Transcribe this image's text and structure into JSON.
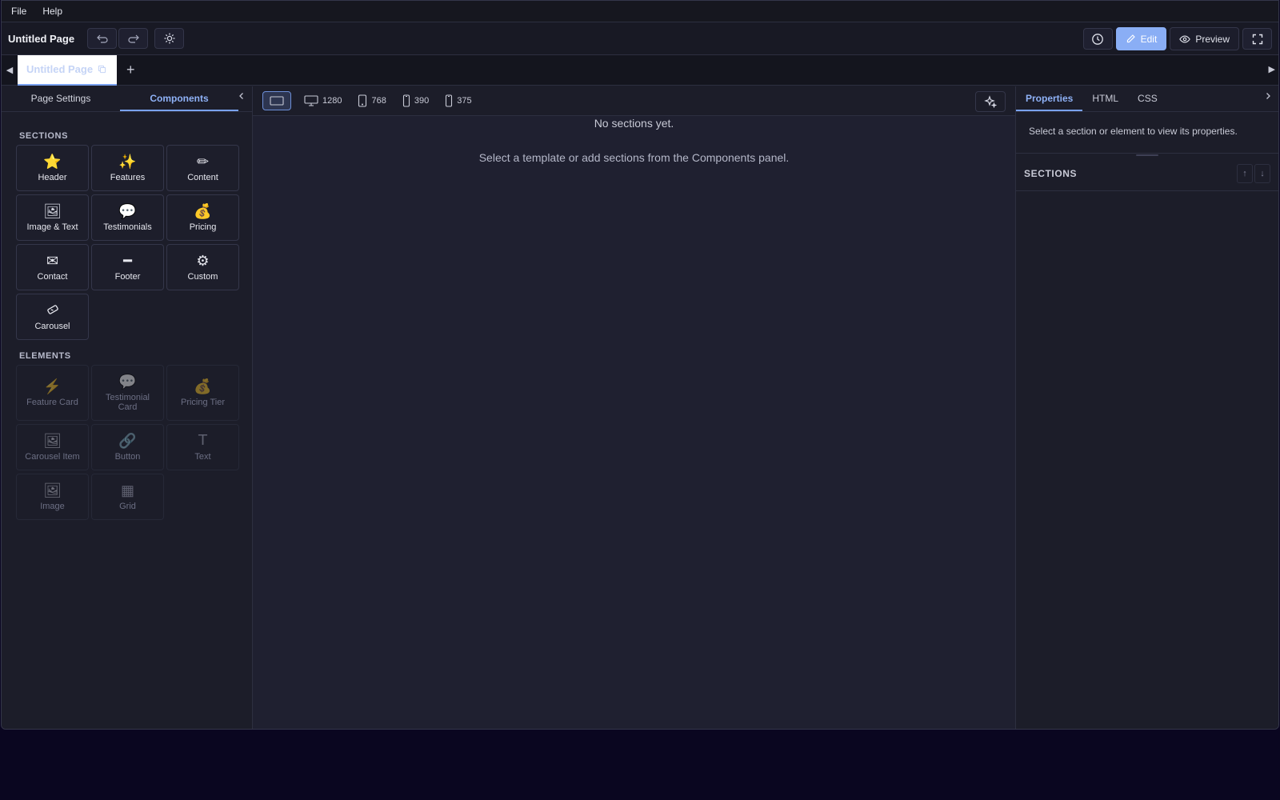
{
  "menu": {
    "file": "File",
    "help": "Help"
  },
  "toolbar": {
    "page_name": "Untitled Page",
    "edit_label": "Edit",
    "preview_label": "Preview"
  },
  "tabs": {
    "active_tab": "Untitled Page",
    "add": "+",
    "left_arrow": "◀",
    "right_arrow": "▶"
  },
  "left_panel": {
    "tabs": [
      "Page Settings",
      "Components"
    ],
    "active_tab": "Components",
    "sections_title": "SECTIONS",
    "sections": [
      {
        "label": "Header",
        "icon": "⭐"
      },
      {
        "label": "Features",
        "icon": "✨"
      },
      {
        "label": "Content",
        "icon": "✏"
      },
      {
        "label": "Image & Text",
        "icon": "🖼"
      },
      {
        "label": "Testimonials",
        "icon": "💬"
      },
      {
        "label": "Pricing",
        "icon": "💰"
      },
      {
        "label": "Contact",
        "icon": "✉"
      },
      {
        "label": "Footer",
        "icon": "━"
      },
      {
        "label": "Custom",
        "icon": "⚙"
      },
      {
        "label": "Carousel",
        "icon": "🎠"
      }
    ],
    "elements_title": "ELEMENTS",
    "elements": [
      {
        "label": "Feature Card",
        "icon": "⚡"
      },
      {
        "label": "Testimonial Card",
        "icon": "💬"
      },
      {
        "label": "Pricing Tier",
        "icon": "💰"
      },
      {
        "label": "Carousel Item",
        "icon": "🖼"
      },
      {
        "label": "Button",
        "icon": "🔗"
      },
      {
        "label": "Text",
        "icon": "T"
      },
      {
        "label": "Image",
        "icon": "🖼"
      },
      {
        "label": "Grid",
        "icon": "▦"
      }
    ]
  },
  "canvas": {
    "devices": [
      {
        "name": "fit",
        "label": ""
      },
      {
        "name": "desktop",
        "label": "1280"
      },
      {
        "name": "tablet",
        "label": "768"
      },
      {
        "name": "phone-large",
        "label": "390"
      },
      {
        "name": "phone-small",
        "label": "375"
      }
    ],
    "empty_title": "No sections yet.",
    "empty_hint": "Select a template or add sections from the Components panel."
  },
  "right_panel": {
    "tabs": [
      "Properties",
      "HTML",
      "CSS"
    ],
    "active_tab": "Properties",
    "properties_message": "Select a section or element to view its properties.",
    "sections_title": "SECTIONS",
    "up": "↑",
    "down": "↓"
  },
  "colors": {
    "accent": "#8aaef5",
    "background": "#1c1d29",
    "desktop": "#0a0620"
  }
}
